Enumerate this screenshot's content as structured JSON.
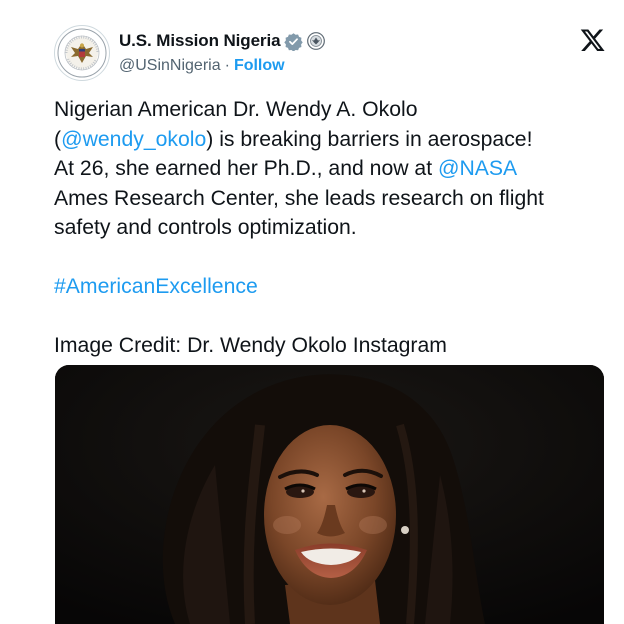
{
  "account": {
    "display_name": "U.S. Mission Nigeria",
    "handle": "@USinNigeria",
    "separator": "·",
    "follow_label": "Follow",
    "avatar_icon": "state-department-seal-icon",
    "verified_icon": "verified-badge-icon",
    "affiliation_icon": "government-seal-icon",
    "verified_color": "#829aab"
  },
  "platform": {
    "logo_icon": "x-logo-icon"
  },
  "tweet": {
    "line1": "Nigerian American Dr. Wendy A. Okolo",
    "line2_open": "(",
    "mention_1": "@wendy_okolo",
    "line2_rest": ") is breaking barriers in aerospace!",
    "line3_pre": "At 26, she earned her Ph.D., and now at ",
    "mention_2": "@NASA",
    "line4": "Ames Research Center, she leads research on flight",
    "line5": "safety and controls optimization.",
    "hashtag": "#AmericanExcellence",
    "credit": "Image Credit: Dr. Wendy Okolo Instagram"
  },
  "media": {
    "type": "photo",
    "icon": "portrait-photo-icon"
  },
  "colors": {
    "text": "#0f1419",
    "secondary": "#536471",
    "link": "#1d9bf0",
    "photo_background": "#0b0a09"
  }
}
